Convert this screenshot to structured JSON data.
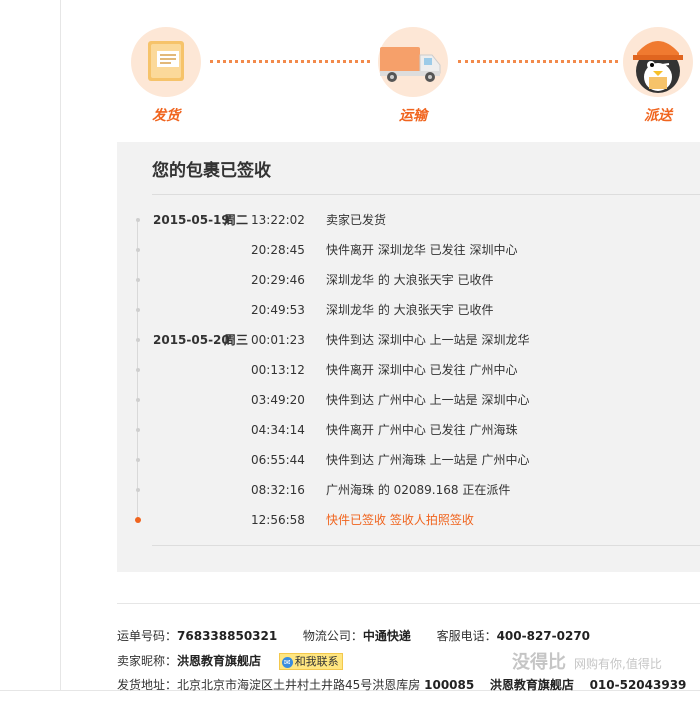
{
  "steps": [
    {
      "label": "发货",
      "icon": "package-icon"
    },
    {
      "label": "运输",
      "icon": "truck-icon"
    },
    {
      "label": "派送",
      "icon": "courier-icon"
    }
  ],
  "panel": {
    "title": "您的包裹已签收"
  },
  "timeline": [
    {
      "date": "2015-05-19",
      "weekday": "周二",
      "time": "13:22:02",
      "desc": "卖家已发货"
    },
    {
      "date": "",
      "weekday": "",
      "time": "20:28:45",
      "desc": "快件离开 深圳龙华 已发往 深圳中心"
    },
    {
      "date": "",
      "weekday": "",
      "time": "20:29:46",
      "desc": "深圳龙华 的 大浪张天宇 已收件"
    },
    {
      "date": "",
      "weekday": "",
      "time": "20:49:53",
      "desc": "深圳龙华 的 大浪张天宇 已收件"
    },
    {
      "date": "2015-05-20",
      "weekday": "周三",
      "time": "00:01:23",
      "desc": "快件到达 深圳中心 上一站是 深圳龙华"
    },
    {
      "date": "",
      "weekday": "",
      "time": "00:13:12",
      "desc": "快件离开 深圳中心 已发往 广州中心"
    },
    {
      "date": "",
      "weekday": "",
      "time": "03:49:20",
      "desc": "快件到达 广州中心 上一站是 深圳中心"
    },
    {
      "date": "",
      "weekday": "",
      "time": "04:34:14",
      "desc": "快件离开 广州中心 已发往 广州海珠"
    },
    {
      "date": "",
      "weekday": "",
      "time": "06:55:44",
      "desc": "快件到达 广州海珠 上一站是 广州中心"
    },
    {
      "date": "",
      "weekday": "",
      "time": "08:32:16",
      "desc": "广州海珠 的 02089.168 正在派件"
    },
    {
      "date": "",
      "weekday": "",
      "time": "12:56:58",
      "desc": "快件已签收 签收人拍照签收"
    }
  ],
  "info": {
    "tracking_label": "运单号码：",
    "tracking_no": "768338850321",
    "company_label": "物流公司：",
    "company": "中通快递",
    "phone_label": "客服电话：",
    "phone": "400-827-0270",
    "seller_label": "卖家昵称：",
    "seller": "洪恩教育旗舰店",
    "chat_label": "和我联系",
    "address_label": "发货地址：",
    "address": "北京北京市海淀区土井村土井路45号洪恩库房",
    "zip": "100085",
    "seller2": "洪恩教育旗舰店",
    "seller_phone": "010-52043939"
  },
  "watermark": {
    "main": "没得比",
    "sub": "网购有你,值得比"
  },
  "colors": {
    "accent": "#f0641e",
    "circle": "#fde7d6",
    "panel": "#f2f2f2"
  }
}
